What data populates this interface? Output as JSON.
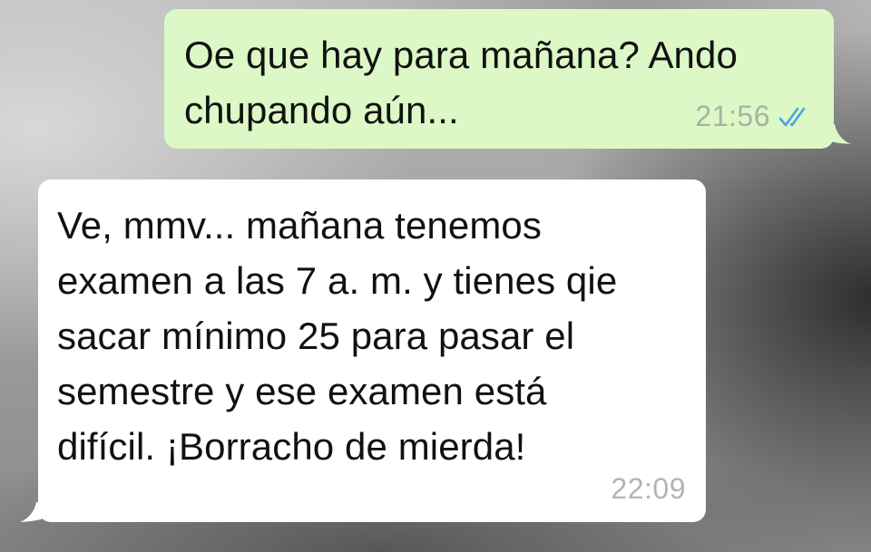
{
  "conversation": {
    "messages": [
      {
        "direction": "outgoing",
        "text": "Oe que hay para mañana? Ando\nchupando aún...",
        "time": "21:56",
        "status_icon": "double-check-read-icon",
        "bubble_color": "#dcf8c6",
        "check_color": "#4fa3e0"
      },
      {
        "direction": "incoming",
        "text": "Ve, mmv... mañana tenemos\nexamen a las 7 a. m. y tienes qie\nsacar mínimo 25 para pasar el\nsemestre y ese examen está\ndifícil. ¡Borracho de mierda!",
        "time": "22:09",
        "bubble_color": "#ffffff"
      }
    ]
  }
}
